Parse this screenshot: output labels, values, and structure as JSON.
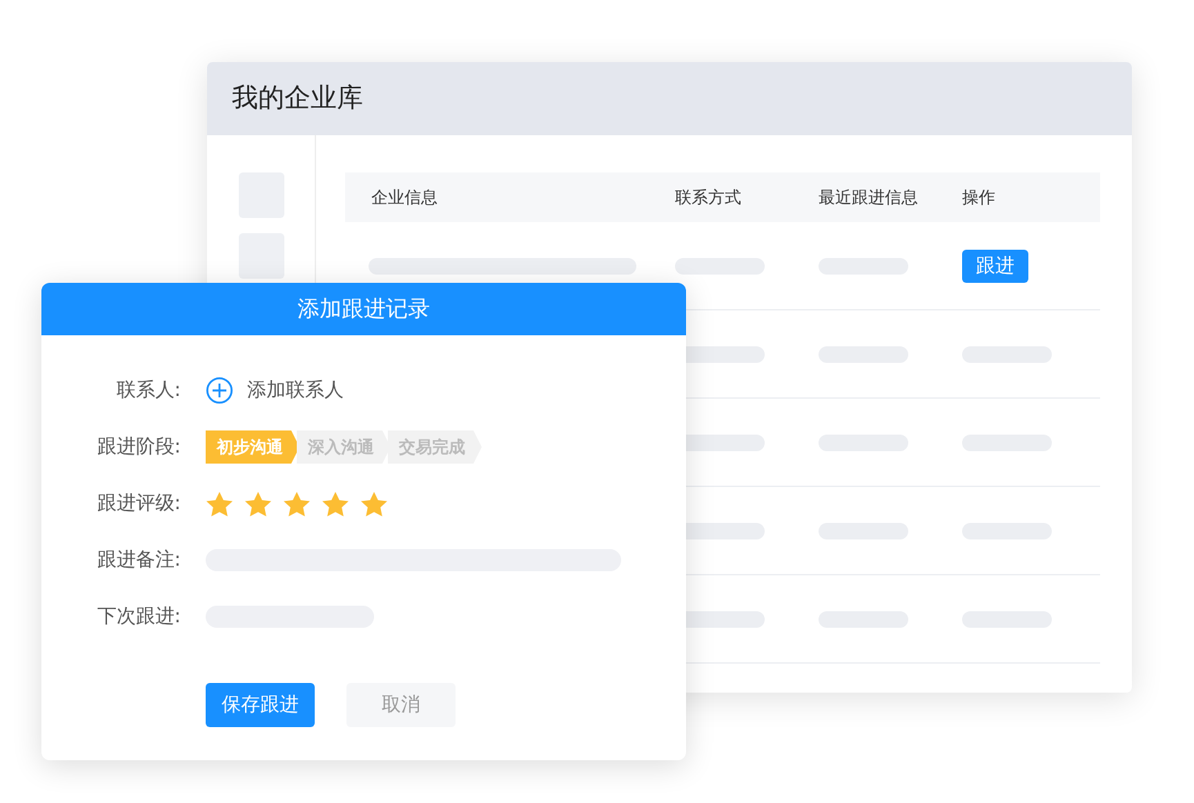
{
  "window": {
    "title": "我的企业库"
  },
  "table": {
    "columns": [
      "企业信息",
      "联系方式",
      "最近跟进信息",
      "操作"
    ],
    "rows": [
      {
        "kind": "action",
        "action": "跟进"
      },
      {
        "kind": "placeholder"
      },
      {
        "kind": "placeholder"
      },
      {
        "kind": "placeholder"
      },
      {
        "kind": "placeholder"
      }
    ]
  },
  "dialog": {
    "title": "添加跟进记录",
    "contact": {
      "label": "联系人:",
      "add_link": "添加联系人"
    },
    "stage": {
      "label": "跟进阶段:",
      "stages": [
        {
          "label": "初步沟通",
          "selected": true
        },
        {
          "label": "深入沟通",
          "selected": false
        },
        {
          "label": "交易完成",
          "selected": false
        }
      ]
    },
    "rating": {
      "label": "跟进评级:",
      "stars": 5
    },
    "note": {
      "label": "跟进备注:"
    },
    "next": {
      "label": "下次跟进:"
    },
    "buttons": [
      {
        "kind": "primary",
        "label": "保存跟进"
      },
      {
        "kind": "secondary",
        "label": "取消"
      }
    ]
  }
}
